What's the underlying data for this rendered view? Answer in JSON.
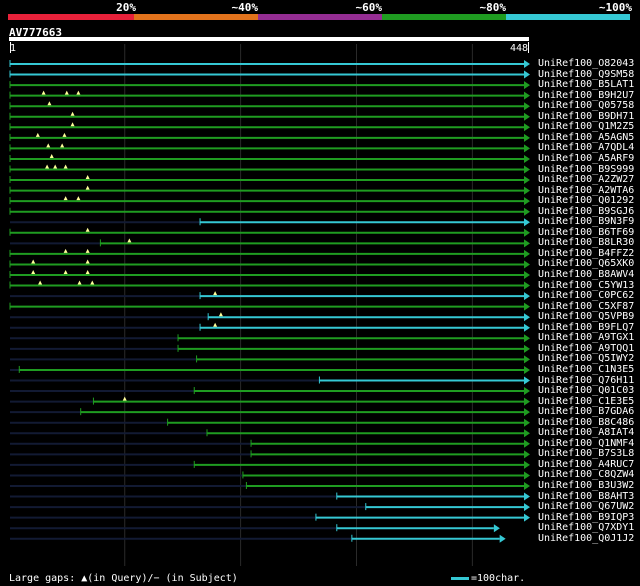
{
  "legend": {
    "labels": [
      "20%",
      "~40%",
      "~60%",
      "~80%",
      "~100%"
    ],
    "colors": [
      "#e8213a",
      "#e2731c",
      "#952d93",
      "#1f9c21",
      "#35c8d4"
    ]
  },
  "query": {
    "name": "AV777663",
    "start": "1",
    "end": "448",
    "length": 448
  },
  "footer": {
    "large_gaps": "Large gaps: ▲(in Query)/− (in Subject)",
    "scale": "=100char."
  },
  "colors": {
    "background": "#000000",
    "gridline": "#2a2a2a",
    "green": "#1f9c21",
    "cyan": "#35c8d4",
    "dark_gap": "#121a33",
    "marker": "#ffff99"
  },
  "chart_data": {
    "type": "table",
    "query_length": 448,
    "gridlines_at": [
      100,
      200,
      300,
      400
    ],
    "hits": [
      {
        "name": "UniRef100_O82043",
        "start": 1,
        "end": 448,
        "color": "cyan",
        "gaps_in_query": []
      },
      {
        "name": "UniRef100_Q9SM58",
        "start": 1,
        "end": 448,
        "color": "cyan",
        "gaps_in_query": []
      },
      {
        "name": "UniRef100_B5LAT1",
        "start": 1,
        "end": 448,
        "color": "green",
        "gaps_in_query": []
      },
      {
        "name": "UniRef100_B9H2U7",
        "start": 1,
        "end": 448,
        "color": "green",
        "gaps_in_query": [
          30,
          50,
          60
        ]
      },
      {
        "name": "UniRef100_Q05758",
        "start": 1,
        "end": 448,
        "color": "green",
        "gaps_in_query": [
          35
        ]
      },
      {
        "name": "UniRef100_B9DH71",
        "start": 1,
        "end": 448,
        "color": "green",
        "gaps_in_query": [
          55
        ]
      },
      {
        "name": "UniRef100_Q1M2Z5",
        "start": 1,
        "end": 448,
        "color": "green",
        "gaps_in_query": [
          55
        ]
      },
      {
        "name": "UniRef100_A5AGN5",
        "start": 1,
        "end": 448,
        "color": "green",
        "gaps_in_query": [
          25,
          48
        ]
      },
      {
        "name": "UniRef100_A7QDL4",
        "start": 1,
        "end": 448,
        "color": "green",
        "gaps_in_query": [
          34,
          46
        ]
      },
      {
        "name": "UniRef100_A5ARF9",
        "start": 1,
        "end": 448,
        "color": "green",
        "gaps_in_query": [
          37
        ]
      },
      {
        "name": "UniRef100_B9S999",
        "start": 1,
        "end": 448,
        "color": "green",
        "gaps_in_query": [
          33,
          40,
          49
        ]
      },
      {
        "name": "UniRef100_A2ZW27",
        "start": 1,
        "end": 448,
        "color": "green",
        "gaps_in_query": [
          68
        ]
      },
      {
        "name": "UniRef100_A2WTA6",
        "start": 1,
        "end": 448,
        "color": "green",
        "gaps_in_query": [
          68
        ]
      },
      {
        "name": "UniRef100_Q01292",
        "start": 1,
        "end": 448,
        "color": "green",
        "gaps_in_query": [
          49,
          60
        ]
      },
      {
        "name": "UniRef100_B9SGJ6",
        "start": 1,
        "end": 448,
        "color": "green",
        "gaps_in_query": []
      },
      {
        "name": "UniRef100_B9N3F9",
        "start": 165,
        "end": 448,
        "color": "cyan",
        "gaps_in_query": []
      },
      {
        "name": "UniRef100_B6TF69",
        "start": 1,
        "end": 448,
        "color": "green",
        "gaps_in_query": [
          68
        ]
      },
      {
        "name": "UniRef100_B8LR30",
        "start": 79,
        "end": 448,
        "color": "green",
        "gaps_in_query": [
          104
        ]
      },
      {
        "name": "UniRef100_B4FFZ2",
        "start": 1,
        "end": 448,
        "color": "green",
        "gaps_in_query": [
          49,
          68
        ]
      },
      {
        "name": "UniRef100_Q65XK0",
        "start": 1,
        "end": 448,
        "color": "green",
        "gaps_in_query": [
          21,
          68
        ]
      },
      {
        "name": "UniRef100_B8AWV4",
        "start": 1,
        "end": 448,
        "color": "green",
        "gaps_in_query": [
          21,
          49,
          68
        ]
      },
      {
        "name": "UniRef100_C5YW13",
        "start": 1,
        "end": 448,
        "color": "green",
        "gaps_in_query": [
          27,
          61,
          72
        ]
      },
      {
        "name": "UniRef100_C0PC62",
        "start": 165,
        "end": 448,
        "color": "cyan",
        "gaps_in_query": [
          178
        ]
      },
      {
        "name": "UniRef100_C5XF87",
        "start": 1,
        "end": 448,
        "color": "green",
        "gaps_in_query": []
      },
      {
        "name": "UniRef100_Q5VPB9",
        "start": 172,
        "end": 448,
        "color": "cyan",
        "gaps_in_query": [
          183
        ]
      },
      {
        "name": "UniRef100_B9FLQ7",
        "start": 165,
        "end": 448,
        "color": "cyan",
        "gaps_in_query": [
          178
        ]
      },
      {
        "name": "UniRef100_A9TGX1",
        "start": 146,
        "end": 448,
        "color": "green",
        "gaps_in_query": []
      },
      {
        "name": "UniRef100_A9TQQ1",
        "start": 146,
        "end": 448,
        "color": "green",
        "gaps_in_query": []
      },
      {
        "name": "UniRef100_Q5IWY2",
        "start": 162,
        "end": 448,
        "color": "green",
        "gaps_in_query": []
      },
      {
        "name": "UniRef100_C1N3E5",
        "start": 9,
        "end": 448,
        "color": "green",
        "gaps_in_query": []
      },
      {
        "name": "UniRef100_Q76H11",
        "start": 268,
        "end": 448,
        "color": "cyan",
        "gaps_in_query": []
      },
      {
        "name": "UniRef100_Q01C03",
        "start": 160,
        "end": 448,
        "color": "green",
        "gaps_in_query": []
      },
      {
        "name": "UniRef100_C1E3E5",
        "start": 73,
        "end": 448,
        "color": "green",
        "gaps_in_query": [
          100
        ]
      },
      {
        "name": "UniRef100_B7GDA6",
        "start": 62,
        "end": 448,
        "color": "green",
        "gaps_in_query": []
      },
      {
        "name": "UniRef100_B8C486",
        "start": 137,
        "end": 448,
        "color": "green",
        "gaps_in_query": []
      },
      {
        "name": "UniRef100_A8IAT4",
        "start": 171,
        "end": 448,
        "color": "green",
        "gaps_in_query": []
      },
      {
        "name": "UniRef100_Q1NMF4",
        "start": 209,
        "end": 448,
        "color": "green",
        "gaps_in_query": []
      },
      {
        "name": "UniRef100_B7S3L8",
        "start": 209,
        "end": 448,
        "color": "green",
        "gaps_in_query": []
      },
      {
        "name": "UniRef100_A4RUC7",
        "start": 160,
        "end": 448,
        "color": "green",
        "gaps_in_query": []
      },
      {
        "name": "UniRef100_C8QZW4",
        "start": 202,
        "end": 448,
        "color": "green",
        "gaps_in_query": []
      },
      {
        "name": "UniRef100_B3U3W2",
        "start": 205,
        "end": 448,
        "color": "green",
        "gaps_in_query": []
      },
      {
        "name": "UniRef100_B8AHT3",
        "start": 283,
        "end": 448,
        "color": "cyan",
        "gaps_in_query": []
      },
      {
        "name": "UniRef100_Q67UW2",
        "start": 308,
        "end": 448,
        "color": "cyan",
        "gaps_in_query": []
      },
      {
        "name": "UniRef100_B9IQP3",
        "start": 265,
        "end": 448,
        "color": "cyan",
        "gaps_in_query": []
      },
      {
        "name": "UniRef100_Q7XDY1",
        "start": 283,
        "end": 422,
        "color": "cyan",
        "gaps_in_query": []
      },
      {
        "name": "UniRef100_Q0J1J2",
        "start": 296,
        "end": 427,
        "color": "cyan",
        "gaps_in_query": []
      }
    ]
  }
}
